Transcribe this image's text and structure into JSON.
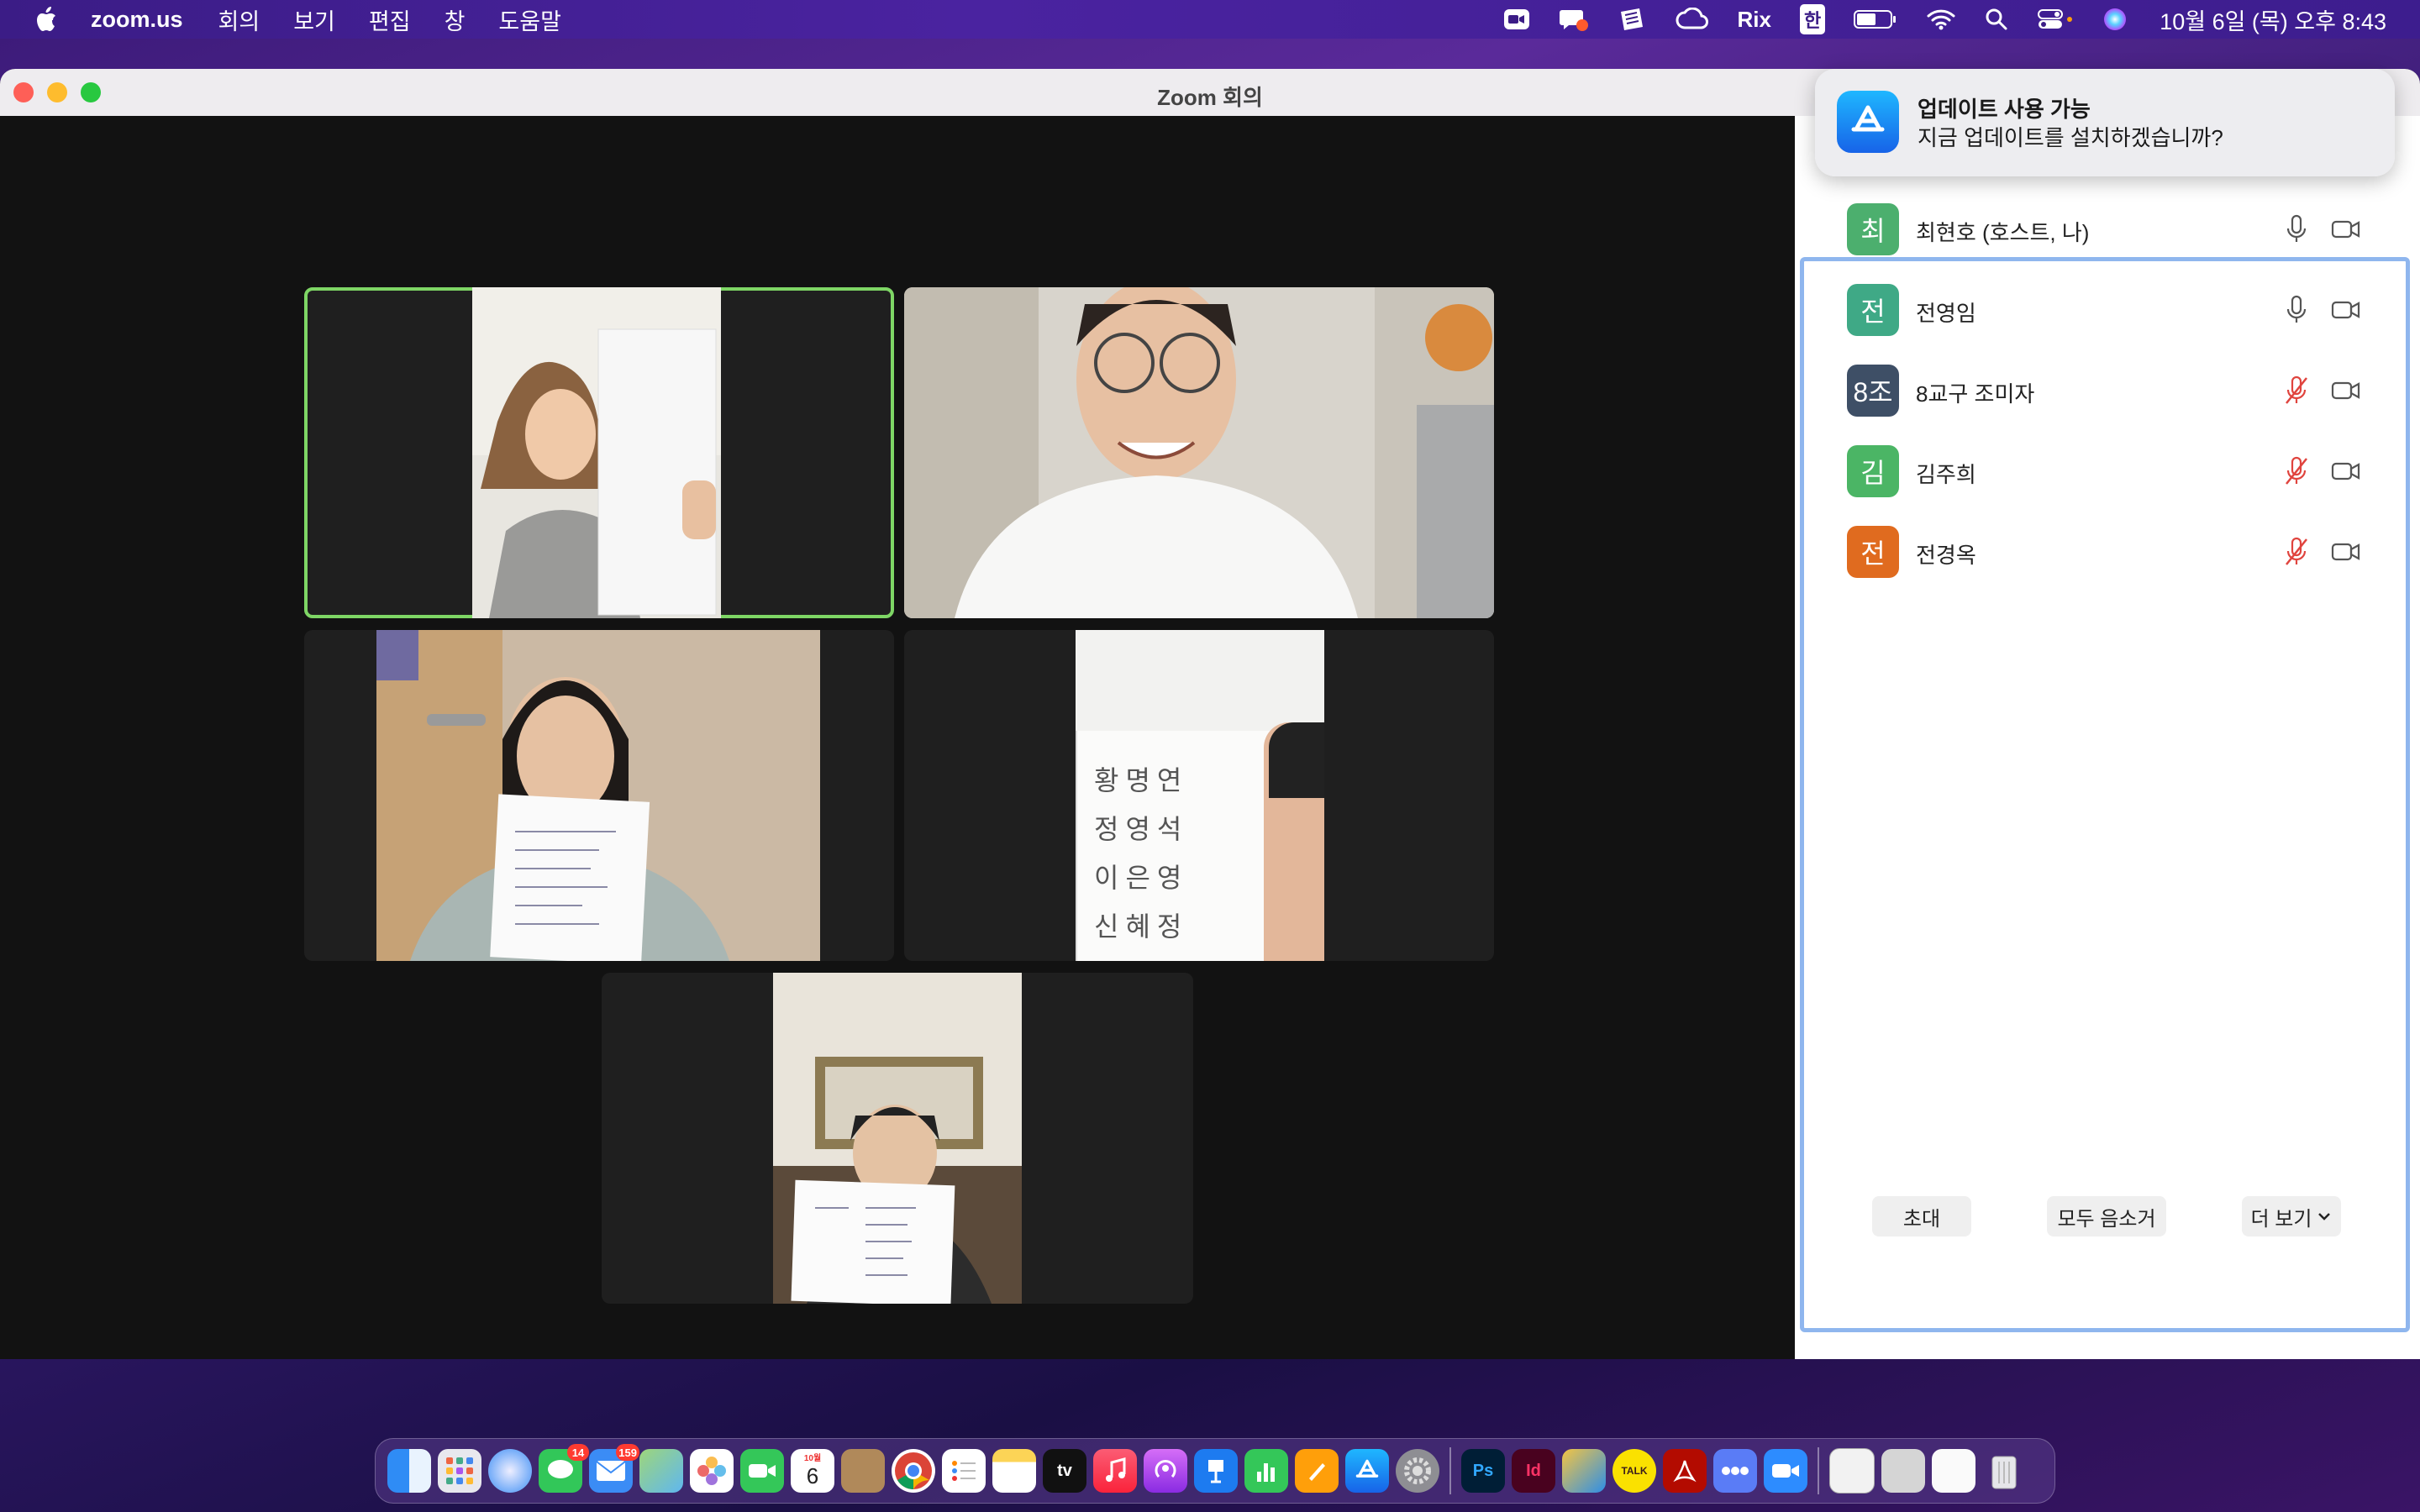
{
  "menubar": {
    "app_name": "zoom.us",
    "menus": [
      "회의",
      "보기",
      "편집",
      "창",
      "도움말"
    ],
    "status": {
      "rix": "Rix",
      "input_method": "한",
      "clock": "10월 6일 (목) 오후 8:43"
    }
  },
  "window": {
    "title": "Zoom 회의"
  },
  "notification": {
    "title": "업데이트 사용 가능",
    "body": "지금 업데이트를 설치하겠습니까?"
  },
  "participants": [
    {
      "avatar": "최",
      "name": "최현호 (호스트, 나)",
      "color": "#4caf6e",
      "muted": false
    },
    {
      "avatar": "전",
      "name": "전영임",
      "color": "#3fa986",
      "muted": false
    },
    {
      "avatar": "8조",
      "name": "8교구 조미자",
      "color": "#3e4f66",
      "muted": true
    },
    {
      "avatar": "김",
      "name": "김주희",
      "color": "#4bb565",
      "muted": true
    },
    {
      "avatar": "전",
      "name": "전경옥",
      "color": "#e06b1f",
      "muted": true
    }
  ],
  "panel_buttons": {
    "invite": "초대",
    "mute_all": "모두 음소거",
    "more": "더 보기"
  },
  "video_tiles": [
    {
      "id": "tile-1",
      "active": true
    },
    {
      "id": "tile-2",
      "active": false
    },
    {
      "id": "tile-3",
      "active": false
    },
    {
      "id": "tile-4",
      "active": false
    },
    {
      "id": "tile-5",
      "active": false
    }
  ],
  "paper_text": {
    "tile4_lines": [
      "황명연",
      "정영석",
      "이은영",
      "신혜정"
    ]
  },
  "dock": {
    "badges": {
      "messages": "14",
      "mail": "159"
    },
    "calendar": {
      "month": "10월",
      "day": "6"
    },
    "app_labels": {
      "appletv": "tv",
      "photoshop": "Ps",
      "indesign": "Id",
      "kakaotalk": "TALK"
    }
  }
}
